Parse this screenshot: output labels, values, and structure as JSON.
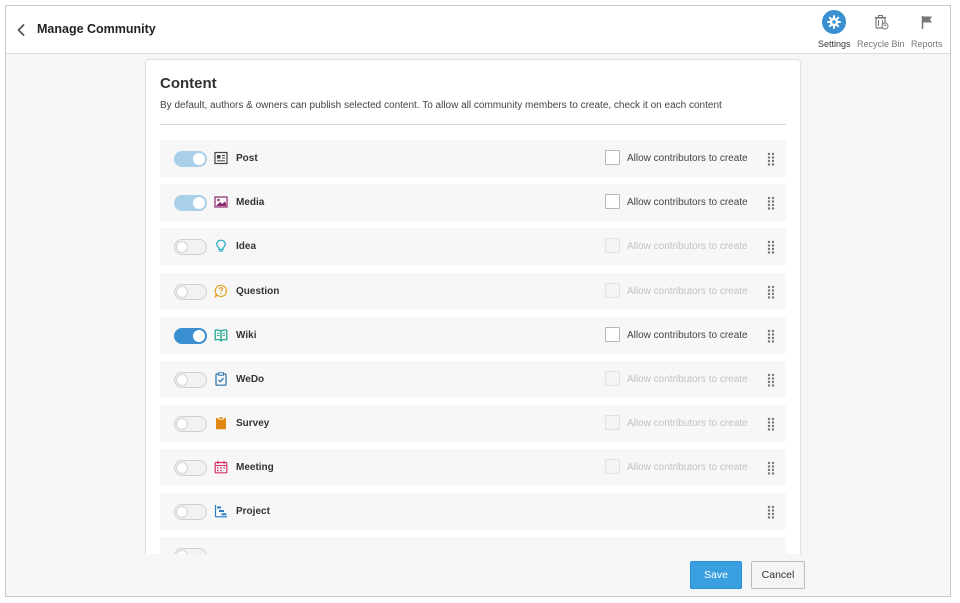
{
  "header": {
    "title": "Manage Community",
    "back_icon": "chevron-left-icon",
    "actions": [
      {
        "label": "Settings",
        "icon": "gear-icon",
        "active": true
      },
      {
        "label": "Recycle Bin",
        "icon": "recycle-bin-icon",
        "active": false
      },
      {
        "label": "Reports",
        "icon": "flag-icon",
        "active": false
      }
    ]
  },
  "content": {
    "title": "Content",
    "description": "By default, authors & owners can publish selected content. To allow all community members to create, check it on each content",
    "items": [
      {
        "label": "Post",
        "icon": "post-icon",
        "enabled": "on-light",
        "contributor_label": "Allow contributors to create",
        "contributor_enabled": true,
        "show_contributor": true
      },
      {
        "label": "Media",
        "icon": "media-icon",
        "enabled": "on-light",
        "contributor_label": "Allow contributors to create",
        "contributor_enabled": true,
        "show_contributor": true
      },
      {
        "label": "Idea",
        "icon": "lightbulb-icon",
        "enabled": "off",
        "contributor_label": "Allow contributors to create",
        "contributor_enabled": false,
        "show_contributor": true
      },
      {
        "label": "Question",
        "icon": "question-icon",
        "enabled": "off",
        "contributor_label": "Allow contributors to create",
        "contributor_enabled": false,
        "show_contributor": true
      },
      {
        "label": "Wiki",
        "icon": "wiki-book-icon",
        "enabled": "on",
        "contributor_label": "Allow contributors to create",
        "contributor_enabled": true,
        "show_contributor": true
      },
      {
        "label": "WeDo",
        "icon": "clipboard-check-icon",
        "enabled": "off",
        "contributor_label": "Allow contributors to create",
        "contributor_enabled": false,
        "show_contributor": true
      },
      {
        "label": "Survey",
        "icon": "survey-clipboard-icon",
        "enabled": "off",
        "contributor_label": "Allow contributors to create",
        "contributor_enabled": false,
        "show_contributor": true
      },
      {
        "label": "Meeting",
        "icon": "calendar-icon",
        "enabled": "off",
        "contributor_label": "Allow contributors to create",
        "contributor_enabled": false,
        "show_contributor": true
      },
      {
        "label": "Project",
        "icon": "gantt-chart-icon",
        "enabled": "off",
        "contributor_label": "",
        "contributor_enabled": false,
        "show_contributor": false
      }
    ]
  },
  "footer": {
    "save_label": "Save",
    "cancel_label": "Cancel"
  },
  "colors": {
    "accent": "#3a8fd0",
    "save_button": "#3a9fe0"
  }
}
